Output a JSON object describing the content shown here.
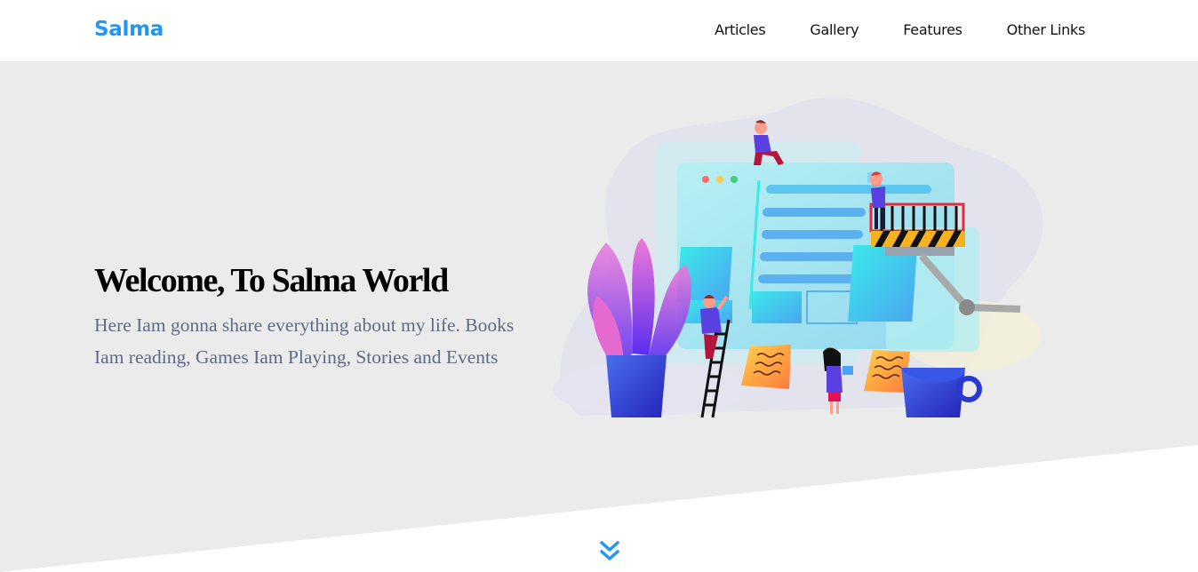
{
  "header": {
    "logo": "Salma",
    "nav": [
      {
        "label": "Articles"
      },
      {
        "label": "Gallery"
      },
      {
        "label": "Features"
      },
      {
        "label": "Other Links"
      }
    ]
  },
  "hero": {
    "title": "Welcome, To Salma World",
    "text": "Here Iam gonna share everything about my life. Books Iam reading, Games Iam Playing, Stories and Events",
    "illustration": "website-construction-illustration",
    "scroll_icon": "double-chevron-down-icon"
  },
  "colors": {
    "brand": "#2196f3",
    "hero_bg": "#ebebeb",
    "hero_text": "#5f6a86",
    "illustration_screen": "#8fe4ea",
    "illustration_accent": "#4b3ff0"
  }
}
